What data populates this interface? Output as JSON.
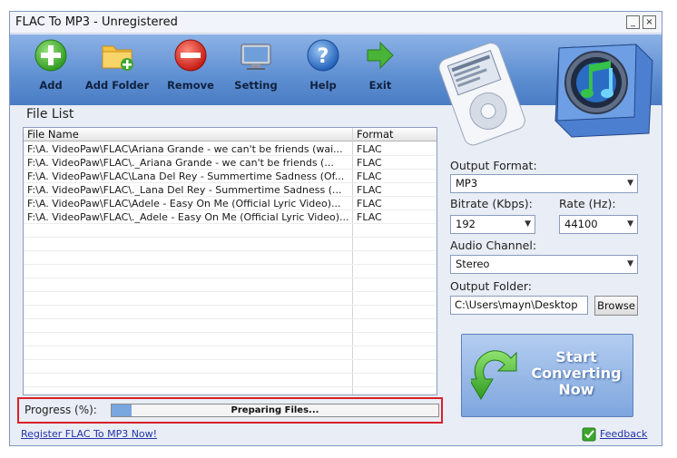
{
  "window": {
    "title": "FLAC To MP3 - Unregistered"
  },
  "toolbar": {
    "items": [
      {
        "label": "Add",
        "icon": "add-icon"
      },
      {
        "label": "Add Folder",
        "icon": "add-folder-icon"
      },
      {
        "label": "Remove",
        "icon": "remove-icon"
      },
      {
        "label": "Setting",
        "icon": "setting-icon"
      },
      {
        "label": "Help",
        "icon": "help-icon"
      },
      {
        "label": "Exit",
        "icon": "exit-arrow-icon"
      }
    ]
  },
  "file_list": {
    "title": "File List",
    "columns": [
      "File Name",
      "Format"
    ],
    "rows": [
      {
        "name": "F:\\A. VideoPaw\\FLAC\\Ariana Grande - we can't be friends (wai...",
        "format": "FLAC"
      },
      {
        "name": "F:\\A. VideoPaw\\FLAC\\._Ariana Grande - we can't be friends (...",
        "format": "FLAC"
      },
      {
        "name": "F:\\A. VideoPaw\\FLAC\\Lana Del Rey - Summertime Sadness (Of...",
        "format": "FLAC"
      },
      {
        "name": "F:\\A. VideoPaw\\FLAC\\._Lana Del Rey - Summertime Sadness (...",
        "format": "FLAC"
      },
      {
        "name": "F:\\A. VideoPaw\\FLAC\\Adele - Easy On Me (Official Lyric Video)...",
        "format": "FLAC"
      },
      {
        "name": "F:\\A. VideoPaw\\FLAC\\._Adele - Easy On Me (Official Lyric Video)...",
        "format": "FLAC"
      }
    ]
  },
  "progress": {
    "label": "Progress (%):",
    "status_text": "Preparing Files...",
    "fraction": 0.06
  },
  "register_link": "Register FLAC To MP3 Now!",
  "settings": {
    "output_format": {
      "label": "Output Format:",
      "value": "MP3"
    },
    "bitrate": {
      "label": "Bitrate (Kbps):",
      "value": "192"
    },
    "rate": {
      "label": "Rate (Hz):",
      "value": "44100"
    },
    "audio_channel": {
      "label": "Audio Channel:",
      "value": "Stereo"
    },
    "output_folder": {
      "label": "Output Folder:",
      "value": "C:\\Users\\mayn\\Desktop",
      "browse_label": "Browse"
    }
  },
  "start_button": {
    "line1": "Start",
    "line2": "Converting",
    "line3": "Now"
  },
  "feedback_link": "Feedback",
  "colors": {
    "accent": "#5e8fd2",
    "highlight_border": "#d8202a",
    "green": "#3ea52e"
  }
}
